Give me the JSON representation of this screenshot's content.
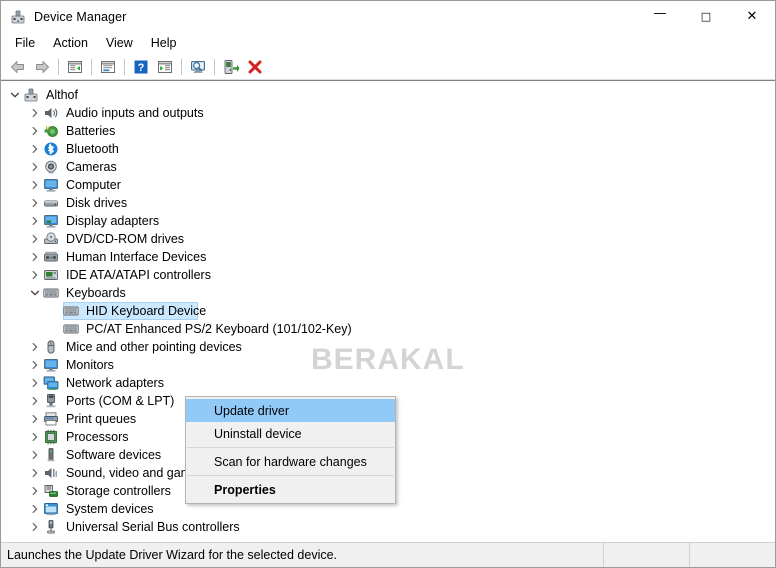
{
  "window": {
    "title": "Device Manager",
    "app_icon": "device-manager-icon",
    "controls": {
      "minimize": "—",
      "maximize": "□",
      "close": "✕"
    }
  },
  "menubar": {
    "items": [
      {
        "label": "File",
        "name": "menu-file"
      },
      {
        "label": "Action",
        "name": "menu-action"
      },
      {
        "label": "View",
        "name": "menu-view"
      },
      {
        "label": "Help",
        "name": "menu-help"
      }
    ]
  },
  "toolbar": {
    "buttons": [
      {
        "name": "back-button",
        "icon": "back-arrow-icon",
        "title": "Back"
      },
      {
        "name": "forward-button",
        "icon": "forward-arrow-icon",
        "title": "Forward"
      },
      {
        "name": "separator-1",
        "icon": "separator"
      },
      {
        "name": "show-hide-console-tree-button",
        "icon": "console-tree-icon",
        "title": "Show/Hide Console Tree"
      },
      {
        "name": "separator-2",
        "icon": "separator"
      },
      {
        "name": "properties-button",
        "icon": "properties-icon",
        "title": "Properties"
      },
      {
        "name": "separator-3",
        "icon": "separator"
      },
      {
        "name": "help-button",
        "icon": "help-question-icon",
        "title": "Help"
      },
      {
        "name": "show-hide-action-pane-button",
        "icon": "action-pane-icon",
        "title": "Show/Hide Action Pane"
      },
      {
        "name": "separator-4",
        "icon": "separator"
      },
      {
        "name": "scan-for-hardware-changes-button",
        "icon": "scan-hardware-icon",
        "title": "Scan for hardware changes"
      },
      {
        "name": "separator-5",
        "icon": "separator"
      },
      {
        "name": "update-driver-button",
        "icon": "update-driver-icon",
        "title": "Update Driver"
      },
      {
        "name": "uninstall-device-button",
        "icon": "red-x-icon",
        "title": "Uninstall device"
      }
    ]
  },
  "tree": {
    "nodes": [
      {
        "label": "Althof",
        "level": 0,
        "expanded": true,
        "icon": "computer-node-icon",
        "selected": false,
        "width": 0
      },
      {
        "label": "Audio inputs and outputs",
        "level": 1,
        "expanded": false,
        "icon": "speaker-icon",
        "selected": false,
        "width": 0
      },
      {
        "label": "Batteries",
        "level": 1,
        "expanded": false,
        "icon": "battery-icon",
        "selected": false,
        "width": 0
      },
      {
        "label": "Bluetooth",
        "level": 1,
        "expanded": false,
        "icon": "bluetooth-icon",
        "selected": false,
        "width": 0
      },
      {
        "label": "Cameras",
        "level": 1,
        "expanded": false,
        "icon": "camera-icon",
        "selected": false,
        "width": 0
      },
      {
        "label": "Computer",
        "level": 1,
        "expanded": false,
        "icon": "monitor-icon",
        "selected": false,
        "width": 0
      },
      {
        "label": "Disk drives",
        "level": 1,
        "expanded": false,
        "icon": "disk-drive-icon",
        "selected": false,
        "width": 0
      },
      {
        "label": "Display adapters",
        "level": 1,
        "expanded": false,
        "icon": "display-adapter-icon",
        "selected": false,
        "width": 0
      },
      {
        "label": "DVD/CD-ROM drives",
        "level": 1,
        "expanded": false,
        "icon": "dvd-drive-icon",
        "selected": false,
        "width": 0
      },
      {
        "label": "Human Interface Devices",
        "level": 1,
        "expanded": false,
        "icon": "hid-icon",
        "selected": false,
        "width": 0
      },
      {
        "label": "IDE ATA/ATAPI controllers",
        "level": 1,
        "expanded": false,
        "icon": "ide-controller-icon",
        "selected": false,
        "width": 0
      },
      {
        "label": "Keyboards",
        "level": 1,
        "expanded": true,
        "icon": "keyboard-icon",
        "selected": false,
        "width": 0
      },
      {
        "label": "HID Keyboard Device",
        "level": 2,
        "expanded": null,
        "icon": "keyboard-icon",
        "selected": true,
        "width": 135
      },
      {
        "label": "PC/AT Enhanced PS/2 Keyboard (101/102-Key)",
        "level": 2,
        "expanded": null,
        "icon": "keyboard-icon",
        "selected": false,
        "width": 0
      },
      {
        "label": "Mice and other pointing devices",
        "level": 1,
        "expanded": false,
        "icon": "mouse-icon",
        "selected": false,
        "width": 0
      },
      {
        "label": "Monitors",
        "level": 1,
        "expanded": false,
        "icon": "monitor-icon",
        "selected": false,
        "width": 0
      },
      {
        "label": "Network adapters",
        "level": 1,
        "expanded": false,
        "icon": "network-adapter-icon",
        "selected": false,
        "width": 0
      },
      {
        "label": "Ports (COM & LPT)",
        "level": 1,
        "expanded": false,
        "icon": "port-icon",
        "selected": false,
        "width": 0
      },
      {
        "label": "Print queues",
        "level": 1,
        "expanded": false,
        "icon": "printer-icon",
        "selected": false,
        "width": 0
      },
      {
        "label": "Processors",
        "level": 1,
        "expanded": false,
        "icon": "processor-icon",
        "selected": false,
        "width": 0
      },
      {
        "label": "Software devices",
        "level": 1,
        "expanded": false,
        "icon": "software-device-icon",
        "selected": false,
        "width": 0
      },
      {
        "label": "Sound, video and game controllers",
        "level": 1,
        "expanded": false,
        "icon": "sound-controller-icon",
        "selected": false,
        "width": 0
      },
      {
        "label": "Storage controllers",
        "level": 1,
        "expanded": false,
        "icon": "storage-controller-icon",
        "selected": false,
        "width": 0
      },
      {
        "label": "System devices",
        "level": 1,
        "expanded": false,
        "icon": "system-device-icon",
        "selected": false,
        "width": 0
      },
      {
        "label": "Universal Serial Bus controllers",
        "level": 1,
        "expanded": false,
        "icon": "usb-icon",
        "selected": false,
        "width": 0
      }
    ]
  },
  "context_menu": {
    "items": [
      {
        "label": "Update driver",
        "name": "ctx-update-driver",
        "active": true,
        "bold": false,
        "type": "item"
      },
      {
        "label": "Uninstall device",
        "name": "ctx-uninstall-device",
        "active": false,
        "bold": false,
        "type": "item"
      },
      {
        "label": "",
        "name": "ctx-separator-1",
        "type": "separator"
      },
      {
        "label": "Scan for hardware changes",
        "name": "ctx-scan-hardware",
        "active": false,
        "bold": false,
        "type": "item"
      },
      {
        "label": "",
        "name": "ctx-separator-2",
        "type": "separator"
      },
      {
        "label": "Properties",
        "name": "ctx-properties",
        "active": false,
        "bold": true,
        "type": "item"
      }
    ]
  },
  "watermark": {
    "text": "BERAKAL"
  },
  "statusbar": {
    "text": "Launches the Update Driver Wizard for the selected device.",
    "cells": 2
  },
  "colors": {
    "selection_fill": "#cbe8ff",
    "selection_border": "#a7d2f5",
    "menu_highlight": "#91c9f7",
    "menu_bg": "#f0f0f0",
    "statusbar_bg": "#f0f0f0",
    "watermark": "#d4d4d4",
    "close_hover": "#e81123"
  }
}
